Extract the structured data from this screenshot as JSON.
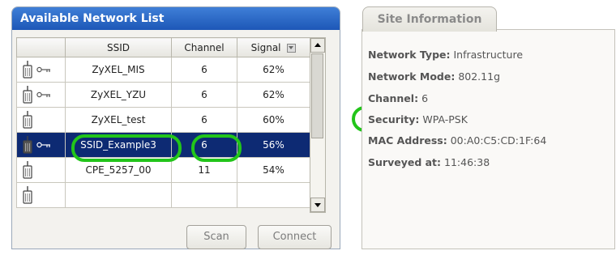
{
  "network_list": {
    "title": "Available Network List",
    "columns": {
      "ssid": "SSID",
      "channel": "Channel",
      "signal": "Signal"
    },
    "rows": [
      {
        "ssid": "ZyXEL_MIS",
        "channel": "6",
        "signal": "62%",
        "secured": true,
        "selected": false
      },
      {
        "ssid": "ZyXEL_YZU",
        "channel": "6",
        "signal": "62%",
        "secured": true,
        "selected": false
      },
      {
        "ssid": "ZyXEL_test",
        "channel": "6",
        "signal": "60%",
        "secured": false,
        "selected": false
      },
      {
        "ssid": "SSID_Example3",
        "channel": "6",
        "signal": "56%",
        "secured": true,
        "selected": true
      },
      {
        "ssid": "CPE_5257_00",
        "channel": "11",
        "signal": "54%",
        "secured": false,
        "selected": false
      },
      {
        "ssid": "",
        "channel": "",
        "signal": "",
        "secured": false,
        "selected": false
      }
    ],
    "buttons": {
      "scan": "Scan",
      "connect": "Connect"
    }
  },
  "site_info": {
    "tab_label": "Site Information",
    "network_type_label": "Network Type:",
    "network_type": "Infrastructure",
    "network_mode_label": "Network Mode:",
    "network_mode": "802.11g",
    "channel_label": "Channel:",
    "channel": "6",
    "security_label": "Security:",
    "security": "WPA-PSK",
    "mac_label": "MAC Address:",
    "mac": "00:A0:C5:CD:1F:64",
    "surveyed_label": "Surveyed at:",
    "surveyed": "11:46:38"
  },
  "colors": {
    "highlight": "#22c51a",
    "selected_row": "#0d2a73",
    "header_blue": "#1d57b7"
  },
  "icons": {
    "access_point": "access-point-icon",
    "key": "key-icon",
    "sort": "sort-icon"
  }
}
